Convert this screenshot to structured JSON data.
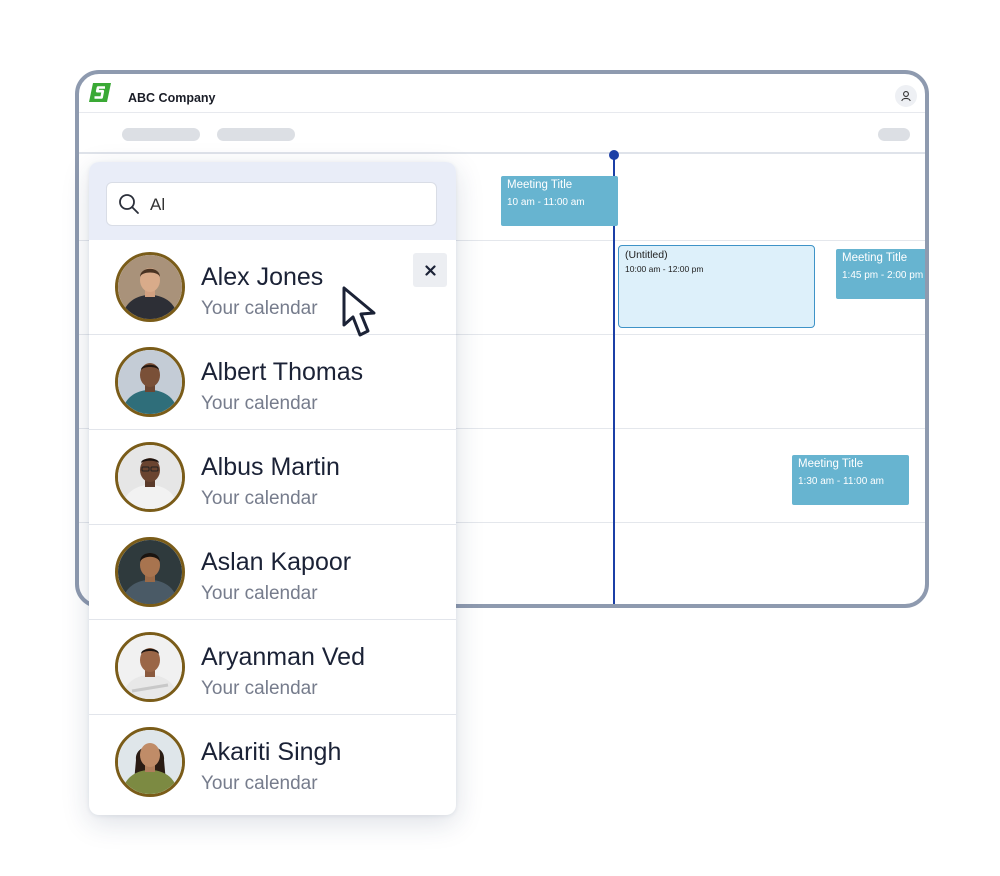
{
  "app": {
    "title": "ABC Company"
  },
  "icons": {
    "logo": "company-logo",
    "user": "user-icon",
    "search": "search-icon",
    "close": "close-icon",
    "cursor": "mouse-pointer-icon"
  },
  "colors": {
    "logo_green": "#3aa935",
    "now_line": "#1b3fa6",
    "event": "#67b4d0",
    "untitled_bg": "#ddf0fa",
    "untitled_border": "#3e93c7",
    "avatar_ring": "#7a5c19"
  },
  "events": [
    {
      "title": "Meeting Title",
      "time": "10 am - 11:00 am"
    },
    {
      "title": "(Untitled)",
      "time": "10:00 am - 12:00 pm"
    },
    {
      "title": "Meeting Title",
      "time": "1:45 pm - 2:00 pm"
    },
    {
      "title": "Meeting Title",
      "time": "1:30 am - 11:00 am"
    }
  ],
  "search": {
    "value": "Al"
  },
  "people": [
    {
      "name": "Alex Jones",
      "subtitle": "Your calendar"
    },
    {
      "name": "Albert Thomas",
      "subtitle": "Your calendar"
    },
    {
      "name": "Albus Martin",
      "subtitle": "Your calendar"
    },
    {
      "name": "Aslan Kapoor",
      "subtitle": "Your calendar"
    },
    {
      "name": "Aryanman Ved",
      "subtitle": "Your calendar"
    },
    {
      "name": "Akariti Singh",
      "subtitle": "Your calendar"
    }
  ]
}
